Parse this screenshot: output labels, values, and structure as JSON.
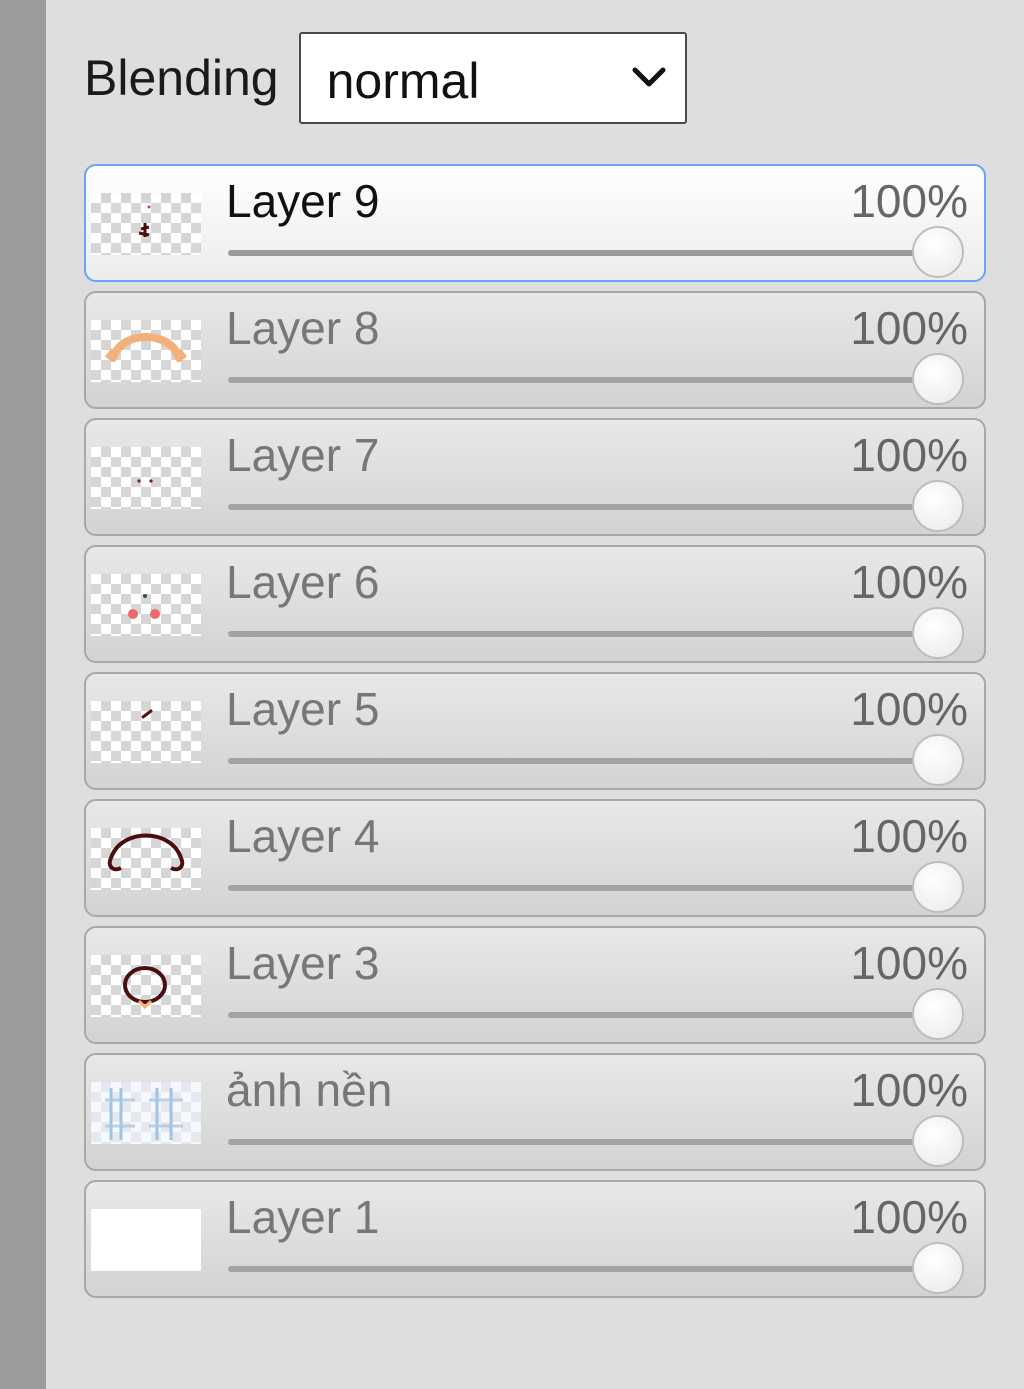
{
  "blending": {
    "label": "Blending",
    "value": "normal"
  },
  "layers": [
    {
      "name": "Layer 9",
      "opacity": "100%",
      "opacity_value": 100,
      "active": true
    },
    {
      "name": "Layer 8",
      "opacity": "100%",
      "opacity_value": 100
    },
    {
      "name": "Layer 7",
      "opacity": "100%",
      "opacity_value": 100
    },
    {
      "name": "Layer 6",
      "opacity": "100%",
      "opacity_value": 100
    },
    {
      "name": "Layer 5",
      "opacity": "100%",
      "opacity_value": 100
    },
    {
      "name": "Layer 4",
      "opacity": "100%",
      "opacity_value": 100
    },
    {
      "name": "Layer 3",
      "opacity": "100%",
      "opacity_value": 100
    },
    {
      "name": "ảnh nền",
      "opacity": "100%",
      "opacity_value": 100
    },
    {
      "name": "Layer 1",
      "opacity": "100%",
      "opacity_value": 100
    }
  ],
  "colors": {
    "active_border": "#6ea2f2",
    "panel_bg": "#dedede"
  },
  "icons": {
    "dropdown": "chevron-down-icon"
  }
}
